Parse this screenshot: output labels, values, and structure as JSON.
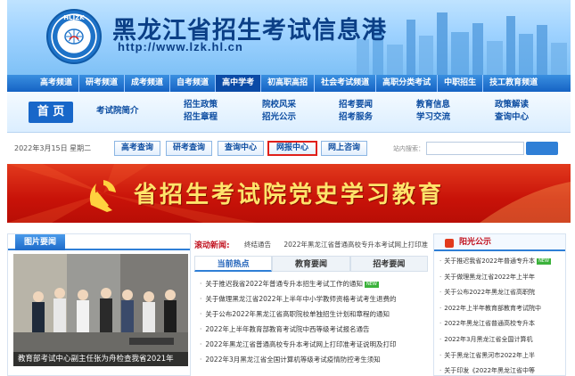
{
  "header": {
    "logo_text": "HLJZK",
    "title": "黑龙江省招生考试信息港",
    "url": "http://www.lzk.hl.cn"
  },
  "channels": [
    "高考频道",
    "研考频道",
    "成考频道",
    "自考频道",
    "高中学考",
    "初高职高招",
    "社会考试频道",
    "高职分类考试",
    "中职招生",
    "技工教育频道"
  ],
  "mainnav": {
    "home": "首 页",
    "columns": [
      [
        "考试院简介"
      ],
      [
        "招生政策",
        "招生章程"
      ],
      [
        "院校风采",
        "招光公示"
      ],
      [
        "招考要闻",
        "招考服务"
      ],
      [
        "教育信息",
        "学习交流"
      ],
      [
        "政策解读",
        "查询中心"
      ]
    ]
  },
  "daterow": {
    "date": "2022年3月15日 星期二",
    "buttons": [
      "高考查询",
      "研考查询",
      "查询中心",
      "网报中心",
      "网上咨询"
    ],
    "search_label": "站内搜索：",
    "search_placeholder": ""
  },
  "red_banner": {
    "title": "省招生考试院党史学习教育"
  },
  "photo_news": {
    "tab": "图片要闻",
    "caption": "教育部考试中心副主任张为舟检查我省2021年"
  },
  "scroll": {
    "label": "滚动新闻:",
    "items": [
      "终结通告",
      "2022年黑龙江省普通高校专升本考试网上打印准"
    ]
  },
  "tabs": [
    "当前热点",
    "教育要闻",
    "招考要闻"
  ],
  "news": [
    "关于推迟我省2022年普通专升本招生考试工作的通知",
    "关于做理黑龙江省2022年上半年中小学教师资格考试考生退费的",
    "关于公布2022年黑龙江省高职院校单独招生计划和章程的通知",
    "2022年上半年教育部教育考试院中西等级考试报名通告",
    "2022年黑龙江省普通高校专升本考试网上打印准考证说明及打印",
    "2022年3月黑龙江省全国计算机等级考试疫情防控考生须知"
  ],
  "news_new_badge": "NEW",
  "sunshine": {
    "title": "阳光公示",
    "items": [
      "关于推迟我省2022年普通专升本",
      "关于做理黑龙江省2022年上半年",
      "关于公布2022年黑龙江省高职院",
      "2022年上半年教育部教育考试院中",
      "2022年黑龙江省普通高校专升本",
      "2022年3月黑龙江省全国计算机",
      "关于黑龙江省黑河市2022年上半",
      "关于印发《2022年黑龙江省中等"
    ]
  },
  "colors": {
    "brand_blue": "#1867c9",
    "red": "#c81208",
    "highlight": "#e0201a"
  }
}
